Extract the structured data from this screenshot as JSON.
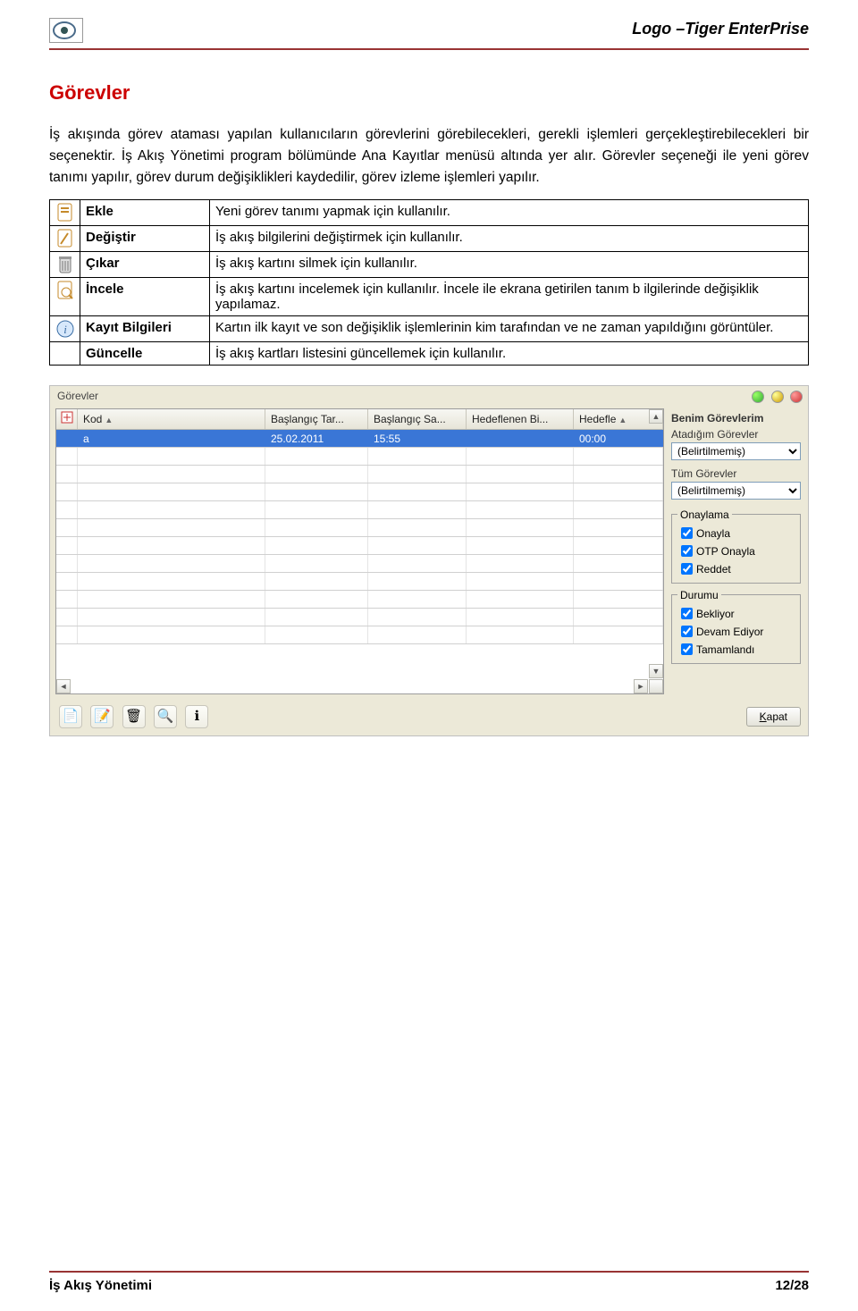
{
  "header": {
    "app_title": "Logo –Tiger EnterPrise"
  },
  "section_title": "Görevler",
  "para1": "İş akışında görev ataması yapılan kullanıcıların görevlerini görebilecekleri, gerekli işlemleri gerçekleştirebilecekleri bir seçenektir. İş Akış Yönetimi program bölümünde Ana Kayıtlar menüsü altında yer alır. Görevler seçeneği ile yeni görev tanımı yapılır, görev durum değişiklikleri kaydedilir, görev izleme işlemleri yapılır.",
  "table": [
    {
      "label": "Ekle",
      "desc": "Yeni görev tanımı yapmak için kullanılır."
    },
    {
      "label": "Değiştir",
      "desc": "İş akış bilgilerini değiştirmek için kullanılır."
    },
    {
      "label": "Çıkar",
      "desc": "İş akış kartını silmek için kullanılır."
    },
    {
      "label": "İncele",
      "desc": "İş akış kartını incelemek için kullanılır. İncele ile ekrana getirilen tanım b ilgilerinde değişiklik yapılamaz."
    },
    {
      "label": "Kayıt Bilgileri",
      "desc": "Kartın ilk kayıt ve son değişiklik işlemlerinin kim tarafından ve ne zaman yapıldığını görüntüler."
    },
    {
      "label": "Güncelle",
      "desc": "İş akış kartları listesini güncellemek için kullanılır."
    }
  ],
  "screenshot": {
    "window_title": "Görevler",
    "grid": {
      "headers": [
        "",
        "Kod",
        "Başlangıç Tar...",
        "Başlangıç Sa...",
        "Hedeflenen Bi...",
        "Hedefle"
      ],
      "row": {
        "kod": "a",
        "bastar": "25.02.2011",
        "bassa": "15:55",
        "hedefbi": "",
        "hedefle": "00:00"
      }
    },
    "side": {
      "my_tasks": "Benim Görevlerim",
      "assigned": "Atadığım Görevler",
      "select_unset": "(Belirtilmemiş)",
      "all_tasks": "Tüm Görevler",
      "approval_legend": "Onaylama",
      "approval": [
        "Onayla",
        "OTP Onayla",
        "Reddet"
      ],
      "status_legend": "Durumu",
      "status": [
        "Bekliyor",
        "Devam Ediyor",
        "Tamamlandı"
      ]
    },
    "close_btn": "Kapat"
  },
  "footer": {
    "left": "İş Akış Yönetimi",
    "right": "12/28"
  }
}
